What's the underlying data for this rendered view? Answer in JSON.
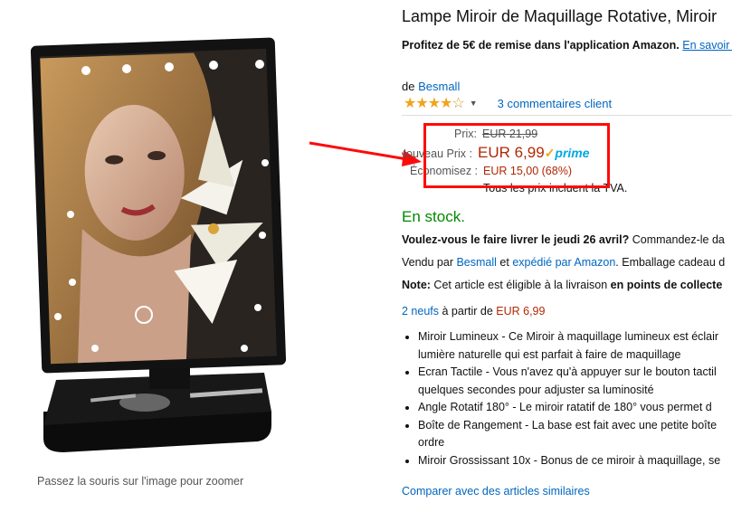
{
  "product": {
    "title": "Lampe Miroir de Maquillage Rotative, Miroir",
    "promo_bold": "Profitez de 5€ de remise dans l'application Amazon.",
    "promo_link": "En savoir plu",
    "by_prefix": "de",
    "brand": "Besmall",
    "rating": 3.5,
    "reviews_label": "3 commentaires client",
    "image_hint": "Passez la souris sur l'image pour zoomer"
  },
  "price": {
    "list_label": "Prix:",
    "list_price": "EUR 21,99",
    "new_label": "Nouveau Prix :",
    "new_price": "EUR 6,99",
    "prime_check": "✓",
    "prime_label": "prime",
    "save_label": "Économisez :",
    "save_value": "EUR 15,00 (68%)",
    "vat_note": "Tous les prix incluent la TVA."
  },
  "availability": {
    "stock": "En stock.",
    "delivery_bold": "Voulez-vous le faire livrer le jeudi 26 avril?",
    "delivery_rest": " Commandez-le da",
    "sold_by_prefix": "Vendu par ",
    "seller": "Besmall",
    "sold_by_mid": " et ",
    "shipped_by": "expédié par Amazon",
    "sold_by_suffix": ". Emballage cadeau d",
    "note_label": "Note:",
    "note_text": " Cet article est éligible à la livraison ",
    "note_bold": "en points de collecte"
  },
  "offers": {
    "count_link": "2 neufs",
    "from_text": " à partir de ",
    "from_price": "EUR 6,99"
  },
  "bullets": [
    [
      "Miroir Lumineux - Ce Miroir à maquillage lumineux est éclair",
      "lumière naturelle qui est parfait à faire de maquillage"
    ],
    [
      "Ecran Tactile - Vous n'avez qu'à appuyer sur le bouton tactil",
      "quelques secondes pour adjuster sa luminosité"
    ],
    [
      "Angle Rotatif 180° - Le miroir ratatif de 180° vous permet d"
    ],
    [
      "Boîte de Rangement - La base est fait avec une petite boîte",
      "ordre"
    ],
    [
      "Miroir Grossissant 10x - Bonus de ce miroir à maquillage, se"
    ]
  ],
  "compare_link": "Comparer avec des articles similaires",
  "colors": {
    "link": "#0066c0",
    "price": "#b12704",
    "stock": "#008a00",
    "prime": "#00a8e1",
    "annotation": "#ff0a0a"
  },
  "icons": [
    "star-icon",
    "prime-check-icon",
    "annotation-arrow-icon",
    "caret-down-icon"
  ]
}
